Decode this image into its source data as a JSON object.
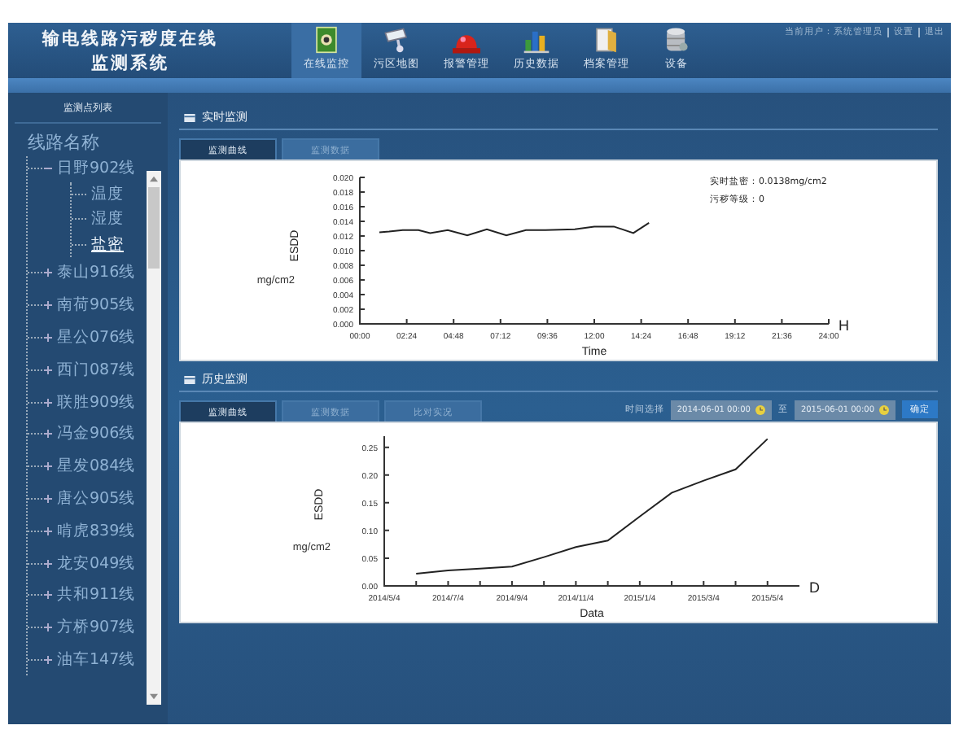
{
  "header": {
    "title_lines": [
      "输电线路污秽度在线",
      "监测系统"
    ],
    "user_links": [
      "当前用户：系统管理员",
      "设置",
      "退出"
    ]
  },
  "nav": [
    {
      "label": "在线监控",
      "kind": "monitor",
      "selected": true
    },
    {
      "label": "污区地图",
      "kind": "camera",
      "selected": false
    },
    {
      "label": "报警管理",
      "kind": "alarm",
      "selected": false
    },
    {
      "label": "历史数据",
      "kind": "bars",
      "selected": false
    },
    {
      "label": "档案管理",
      "kind": "folder",
      "selected": false
    },
    {
      "label": "设备",
      "kind": "database",
      "selected": false
    }
  ],
  "sidebar": {
    "title": "监测点列表",
    "tree": {
      "label": "线路名称",
      "children": [
        {
          "label": "日野902线",
          "expanded": true,
          "children": [
            {
              "label": "温度",
              "selected": false
            },
            {
              "label": "湿度",
              "selected": false
            },
            {
              "label": "盐密",
              "selected": true
            }
          ]
        },
        {
          "label": "泰山916线",
          "expanded": false
        },
        {
          "label": "南荷905线",
          "expanded": false
        },
        {
          "label": "星公076线",
          "expanded": false
        },
        {
          "label": "西门087线",
          "expanded": false
        },
        {
          "label": "联胜909线",
          "expanded": false
        },
        {
          "label": "冯金906线",
          "expanded": false
        },
        {
          "label": "星发084线",
          "expanded": false
        },
        {
          "label": "唐公905线",
          "expanded": false
        },
        {
          "label": "啃虎839线",
          "expanded": false
        },
        {
          "label": "龙安049线",
          "expanded": false
        },
        {
          "label": "共和911线",
          "expanded": false
        },
        {
          "label": "方桥907线",
          "expanded": false
        },
        {
          "label": "油车147线",
          "expanded": false
        }
      ]
    }
  },
  "realtime": {
    "title": "实时监测",
    "tabs": [
      {
        "label": "监测曲线",
        "selected": true
      },
      {
        "label": "监测数据",
        "selected": false
      }
    ],
    "readings": [
      "实时盐密：0.0138mg/cm2",
      "污秽等级：0"
    ],
    "chart_data": {
      "type": "line",
      "xlabel": "Time",
      "ylabel": "ESDD",
      "annotations": [
        {
          "text": "mg/cm2"
        },
        {
          "text": "H"
        }
      ],
      "x": [
        1,
        1.5,
        2.2,
        3,
        3.6,
        4.5,
        5.5,
        6.5,
        7.5,
        8.5,
        9.5,
        11,
        12,
        13,
        14,
        14.8
      ],
      "series": [
        {
          "color": "#222222",
          "values": [
            0.0125,
            0.0126,
            0.0128,
            0.0128,
            0.0124,
            0.0128,
            0.0121,
            0.0129,
            0.0121,
            0.0128,
            0.0128,
            0.0129,
            0.0133,
            0.0133,
            0.0124,
            0.0138
          ]
        }
      ],
      "xlim": [
        0,
        24
      ],
      "ylim": [
        0,
        0.02
      ],
      "xticks": [
        {
          "value": 0,
          "label": "00:00"
        },
        {
          "value": 2.4,
          "label": "02:24"
        },
        {
          "value": 4.8,
          "label": "04:48"
        },
        {
          "value": 7.2,
          "label": "07:12"
        },
        {
          "value": 9.6,
          "label": "09:36"
        },
        {
          "value": 12,
          "label": "12:00"
        },
        {
          "value": 14.4,
          "label": "14:24"
        },
        {
          "value": 16.8,
          "label": "16:48"
        },
        {
          "value": 19.2,
          "label": "19:12"
        },
        {
          "value": 21.6,
          "label": "21:36"
        },
        {
          "value": 24,
          "label": "24:00"
        }
      ],
      "yticks": [
        {
          "value": 0,
          "label": "0.000"
        },
        {
          "value": 0.002,
          "label": "0.002"
        },
        {
          "value": 0.004,
          "label": "0.004"
        },
        {
          "value": 0.006,
          "label": "0.006"
        },
        {
          "value": 0.008,
          "label": "0.008"
        },
        {
          "value": 0.01,
          "label": "0.010"
        },
        {
          "value": 0.012,
          "label": "0.012"
        },
        {
          "value": 0.014,
          "label": "0.014"
        },
        {
          "value": 0.016,
          "label": "0.016"
        },
        {
          "value": 0.018,
          "label": "0.018"
        },
        {
          "value": 0.02,
          "label": "0.020"
        }
      ]
    }
  },
  "history": {
    "title": "历史监测",
    "tabs": [
      {
        "label": "监测曲线",
        "selected": true
      },
      {
        "label": "监测数据",
        "selected": false
      },
      {
        "label": "比对实况",
        "selected": false
      }
    ],
    "range_label": "时间选择",
    "start": "2014-06-01 00:00",
    "between": "至",
    "end": "2015-06-01 00:00",
    "button": "确定",
    "chart_data": {
      "type": "line",
      "xlabel": "Data",
      "ylabel": "ESDD",
      "annotations": [
        {
          "text": "mg/cm2"
        },
        {
          "text": "D"
        }
      ],
      "categories": [
        "2014/5/4",
        null,
        "2014/7/4",
        null,
        "2014/9/4",
        null,
        "2014/11/4",
        null,
        "2015/1/4",
        null,
        "2015/3/4",
        null,
        "2015/5/4"
      ],
      "series": [
        {
          "color": "#222222",
          "values": [
            null,
            0.022,
            0.028,
            0.031,
            0.035,
            0.052,
            0.07,
            0.082,
            0.125,
            0.168,
            0.19,
            0.21,
            0.265
          ]
        }
      ],
      "ylim": [
        0,
        0.27
      ],
      "yticks": [
        {
          "value": 0,
          "label": "0.00"
        },
        {
          "value": 0.05,
          "label": "0.05"
        },
        {
          "value": 0.1,
          "label": "0.10"
        },
        {
          "value": 0.15,
          "label": "0.15"
        },
        {
          "value": 0.2,
          "label": "0.20"
        },
        {
          "value": 0.25,
          "label": "0.25"
        }
      ]
    }
  }
}
